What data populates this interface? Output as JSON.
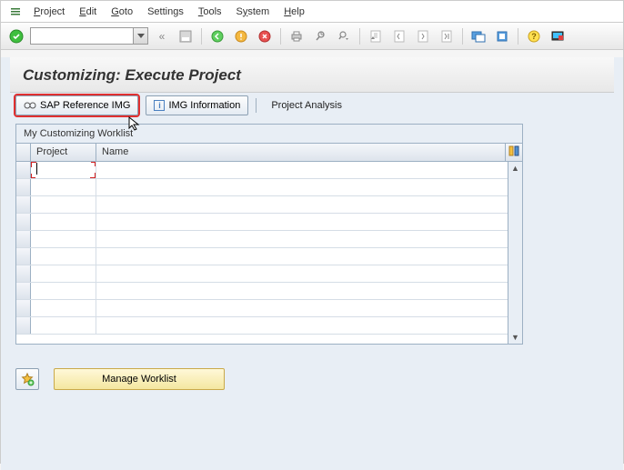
{
  "menu": {
    "items": [
      {
        "label": "Project",
        "accel": "P"
      },
      {
        "label": "Edit",
        "accel": "E"
      },
      {
        "label": "Goto",
        "accel": "G"
      },
      {
        "label": "Settings",
        "accel": ""
      },
      {
        "label": "Tools",
        "accel": "T"
      },
      {
        "label": "System",
        "accel": "S"
      },
      {
        "label": "Help",
        "accel": "H"
      }
    ]
  },
  "page": {
    "title": "Customizing: Execute Project"
  },
  "appbar": {
    "sap_ref_img": "SAP Reference IMG",
    "img_info": "IMG Information",
    "project_analysis": "Project Analysis"
  },
  "panel": {
    "title": "My Customizing Worklist",
    "columns": {
      "project": "Project",
      "name": "Name"
    }
  },
  "bottom": {
    "manage": "Manage Worklist"
  },
  "icons": {
    "enter": "enter-icon",
    "save": "save-icon",
    "back": "back-icon",
    "exit": "exit-icon",
    "cancel": "cancel-icon",
    "print": "print-icon",
    "find": "find-icon",
    "findnext": "find-next-icon",
    "first": "first-page-icon",
    "prev": "prev-page-icon",
    "next": "next-page-icon",
    "last": "last-page-icon",
    "newwin": "new-session-icon",
    "shortcut": "shortcut-icon",
    "help": "help-icon",
    "layout": "layout-icon"
  }
}
